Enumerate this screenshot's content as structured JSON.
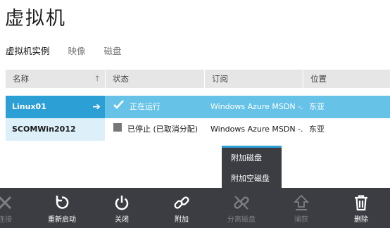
{
  "page": {
    "title": "虚拟机"
  },
  "tabs": [
    {
      "label": "虚拟机实例",
      "active": true
    },
    {
      "label": "映像",
      "active": false
    },
    {
      "label": "磁盘",
      "active": false
    }
  ],
  "table": {
    "columns": [
      "名称",
      "状态",
      "订阅",
      "位置"
    ],
    "sort_icon": "arrow-up-icon",
    "rows": [
      {
        "name": "Linux01",
        "status": "正在运行",
        "status_icon": "checkmark-icon",
        "subscription": "Windows Azure MSDN -...",
        "location": "东亚",
        "selected": true
      },
      {
        "name": "SCOMWin2012",
        "status": "已停止 (已取消分配)",
        "status_icon": "stopped-square-icon",
        "subscription": "Windows Azure MSDN -...",
        "location": "东亚",
        "selected": false
      }
    ]
  },
  "popup_menu": {
    "items": [
      "附加磁盘",
      "附加空磁盘"
    ]
  },
  "command_bar": {
    "items": [
      {
        "label": "连接",
        "icon": "connect-icon",
        "enabled": false
      },
      {
        "label": "重新启动",
        "icon": "restart-icon",
        "enabled": true
      },
      {
        "label": "关闭",
        "icon": "power-icon",
        "enabled": true
      },
      {
        "label": "附加",
        "icon": "link-icon",
        "enabled": true
      },
      {
        "label": "分离磁盘",
        "icon": "unlink-icon",
        "enabled": false
      },
      {
        "label": "捕获",
        "icon": "capture-icon",
        "enabled": false
      },
      {
        "label": "删除",
        "icon": "trash-icon",
        "enabled": true
      }
    ]
  },
  "colors": {
    "accent": "#2c9fd5",
    "selected_row": "#67c2e8",
    "command_bar": "#3b3d42",
    "status_stopped": "#777777"
  }
}
